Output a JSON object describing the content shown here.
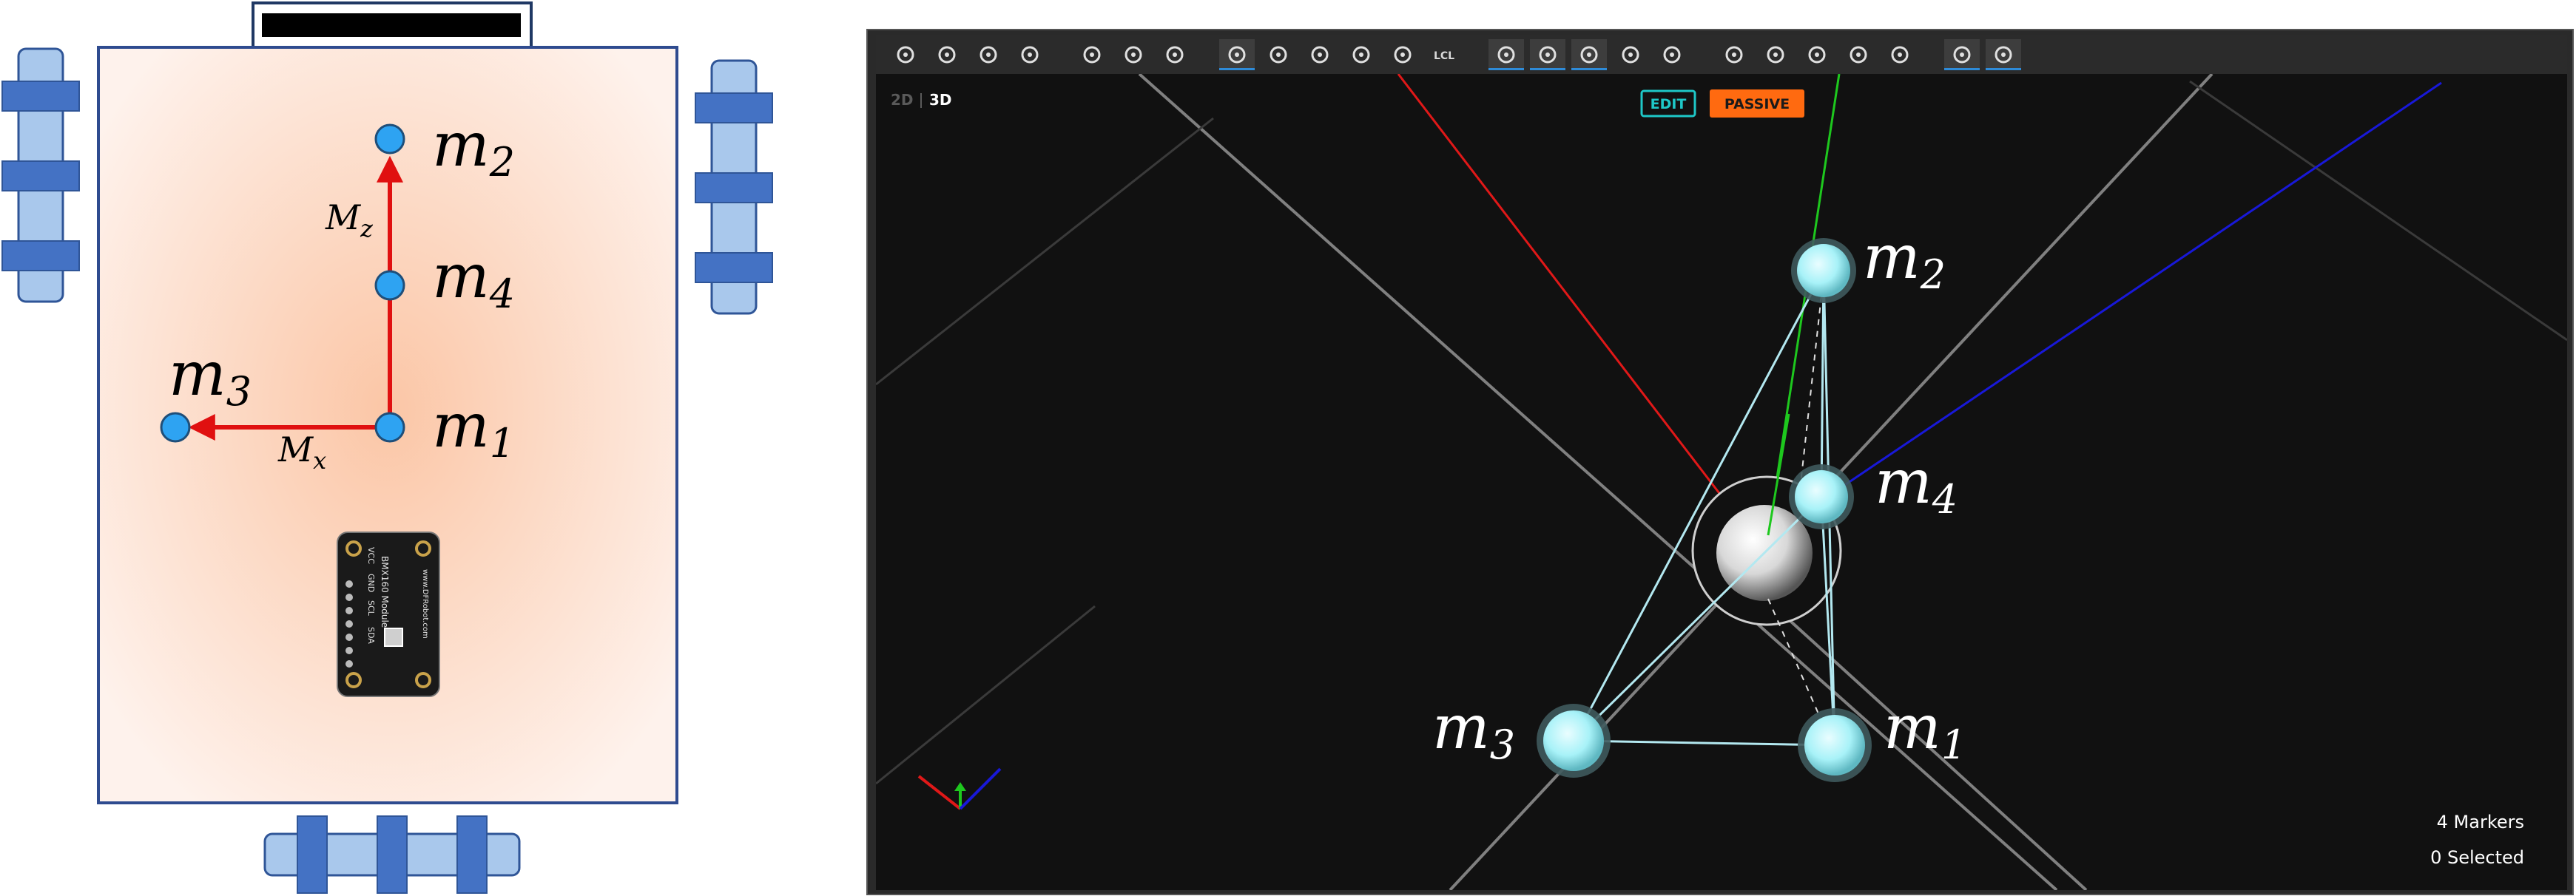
{
  "left_panel": {
    "markers": [
      {
        "id": "m1",
        "base": "m",
        "sub": "1"
      },
      {
        "id": "m2",
        "base": "m",
        "sub": "2"
      },
      {
        "id": "m3",
        "base": "m",
        "sub": "3"
      },
      {
        "id": "m4",
        "base": "m",
        "sub": "4"
      }
    ],
    "axes": [
      {
        "id": "Mz",
        "base": "M",
        "sub": "z"
      },
      {
        "id": "Mx",
        "base": "M",
        "sub": "x"
      }
    ],
    "sensor": {
      "pin_labels": [
        "VCC",
        "GND",
        "SCL",
        "SDA"
      ],
      "board_text": "BMX160 Module",
      "url_text": "www.DFRobot.com"
    },
    "colors": {
      "body_fill": "#fde3d5",
      "marker_fill": "#2ea3f2",
      "arrow": "#e01010",
      "wheel": "#a9c8ec",
      "wheel_clamp": "#4472c4"
    }
  },
  "viewer": {
    "toolbar_icons": [
      "grid-icon",
      "cube-icon",
      "camera-icon",
      "nodes-icon",
      "zoom-in-icon",
      "zoom-region-icon",
      "zoom-fit-icon",
      "select-cursor-icon",
      "move-icon",
      "rotate-icon",
      "scale-icon",
      "skeleton-edit-icon",
      "lcl-icon",
      "marker-select-icon",
      "camera-select-icon",
      "rigidbody-select-icon",
      "skeleton-select-icon",
      "custom-select-icon",
      "visibility-eye-icon",
      "marker-view-icon",
      "camera-view-icon",
      "rigidbody-view-icon",
      "skeleton-view-icon",
      "bone-view-icon",
      "body-view-icon"
    ],
    "lcl_label": "LCL",
    "view_2d": "2D",
    "view_3d": "3D",
    "edit_label": "EDIT",
    "passive_label": "PASSIVE",
    "markers_count": "4 Markers",
    "selected_count": "0 Selected",
    "markers": [
      {
        "id": "m1",
        "base": "m",
        "sub": "1"
      },
      {
        "id": "m2",
        "base": "m",
        "sub": "2"
      },
      {
        "id": "m3",
        "base": "m",
        "sub": "3"
      },
      {
        "id": "m4",
        "base": "m",
        "sub": "4"
      }
    ],
    "colors": {
      "bg": "#111111",
      "toolbar_bg": "#2b2b2b",
      "grid": "#8a8a8a",
      "x_axis": "#e01818",
      "y_axis": "#1ec81e",
      "z_axis": "#1818d8",
      "marker": "#9ff0f6",
      "edge": "#b3e8f0",
      "edit": "#1ec8c8",
      "passive": "#ff6a10"
    }
  }
}
